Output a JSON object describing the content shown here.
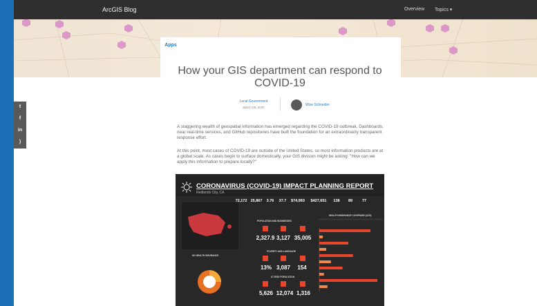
{
  "header": {
    "brand": "ArcGIS Blog",
    "nav_overview": "Overview",
    "nav_topics": "Topics ▾"
  },
  "post": {
    "tag": "Apps",
    "title": "How your GIS department can respond to COVID-19",
    "category": "Local Government",
    "date": "March 09, 2020",
    "author": "Wise Schneider",
    "paragraphs": [
      "A staggering wealth of geospatial information has emerged regarding the COVID-19 outbreak. Dashboards, near real-time services, and GitHub repositories have built the foundation for an extraordinarily transparent response effort.",
      "At this point, most cases of COVID-19 are outside of the United States, so most information products are at a global scale. As cases begin to surface domestically, your GIS division might be asking: \"How can we apply this information to prepare locally?\""
    ]
  },
  "share": {
    "icons": [
      "twitter-icon",
      "facebook-icon",
      "linkedin-icon",
      "rss-icon"
    ]
  },
  "report": {
    "title": "CORONAVIRUS (COVID-19) IMPACT PLANNING REPORT",
    "subtitle": "Redlands City, CA",
    "stats": [
      "72,172",
      "25,867",
      "3.76",
      "37.7",
      "$74,993",
      "$427,651",
      "138",
      "89",
      "77"
    ],
    "section_population": "POPULATION AND BUSINESSES",
    "big_numbers_row1": [
      "2,327.9",
      "3,127",
      "35,005"
    ],
    "section_poverty": "POVERTY AND LANGUAGE",
    "big_numbers_row2": [
      "13%",
      "3,087",
      "154"
    ],
    "section_at_risk": "AT RISK POPULATION",
    "big_numbers_row3": [
      "5,626",
      "12,074",
      "1,316"
    ],
    "no_health_insurance": "NO HEALTH INSURANCE",
    "health_coverage": "HEALTH INSURANCE COVERAGE (ACS)",
    "bar_values": [
      88,
      6,
      50,
      12,
      58,
      20,
      40,
      8,
      100,
      14
    ]
  },
  "colors": {
    "accent": "#e8472e",
    "link": "#2a7ac1",
    "page_bg": "#1b6fb5",
    "hexagon": "#d98ac8"
  }
}
